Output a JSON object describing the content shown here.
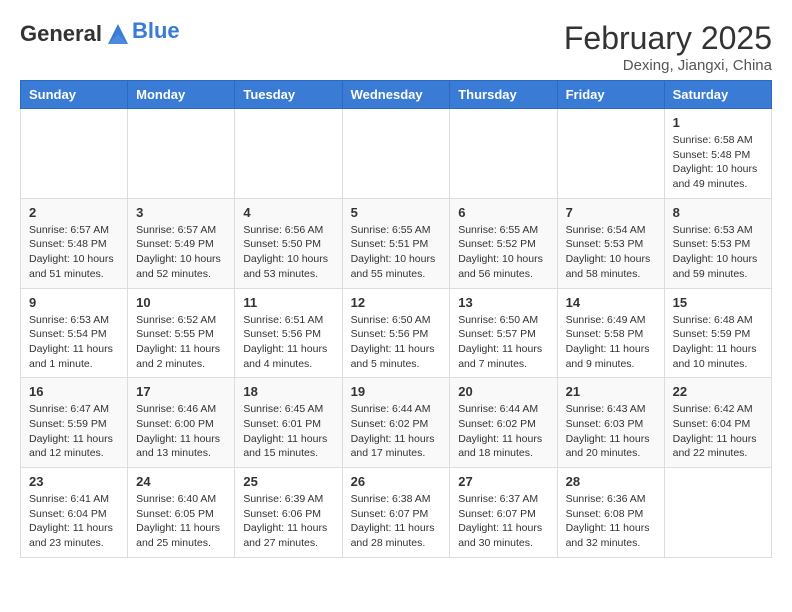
{
  "header": {
    "logo_general": "General",
    "logo_blue": "Blue",
    "month_year": "February 2025",
    "location": "Dexing, Jiangxi, China"
  },
  "weekdays": [
    "Sunday",
    "Monday",
    "Tuesday",
    "Wednesday",
    "Thursday",
    "Friday",
    "Saturday"
  ],
  "weeks": [
    [
      {
        "day": "",
        "info": ""
      },
      {
        "day": "",
        "info": ""
      },
      {
        "day": "",
        "info": ""
      },
      {
        "day": "",
        "info": ""
      },
      {
        "day": "",
        "info": ""
      },
      {
        "day": "",
        "info": ""
      },
      {
        "day": "1",
        "info": "Sunrise: 6:58 AM\nSunset: 5:48 PM\nDaylight: 10 hours and 49 minutes."
      }
    ],
    [
      {
        "day": "2",
        "info": "Sunrise: 6:57 AM\nSunset: 5:48 PM\nDaylight: 10 hours and 51 minutes."
      },
      {
        "day": "3",
        "info": "Sunrise: 6:57 AM\nSunset: 5:49 PM\nDaylight: 10 hours and 52 minutes."
      },
      {
        "day": "4",
        "info": "Sunrise: 6:56 AM\nSunset: 5:50 PM\nDaylight: 10 hours and 53 minutes."
      },
      {
        "day": "5",
        "info": "Sunrise: 6:55 AM\nSunset: 5:51 PM\nDaylight: 10 hours and 55 minutes."
      },
      {
        "day": "6",
        "info": "Sunrise: 6:55 AM\nSunset: 5:52 PM\nDaylight: 10 hours and 56 minutes."
      },
      {
        "day": "7",
        "info": "Sunrise: 6:54 AM\nSunset: 5:53 PM\nDaylight: 10 hours and 58 minutes."
      },
      {
        "day": "8",
        "info": "Sunrise: 6:53 AM\nSunset: 5:53 PM\nDaylight: 10 hours and 59 minutes."
      }
    ],
    [
      {
        "day": "9",
        "info": "Sunrise: 6:53 AM\nSunset: 5:54 PM\nDaylight: 11 hours and 1 minute."
      },
      {
        "day": "10",
        "info": "Sunrise: 6:52 AM\nSunset: 5:55 PM\nDaylight: 11 hours and 2 minutes."
      },
      {
        "day": "11",
        "info": "Sunrise: 6:51 AM\nSunset: 5:56 PM\nDaylight: 11 hours and 4 minutes."
      },
      {
        "day": "12",
        "info": "Sunrise: 6:50 AM\nSunset: 5:56 PM\nDaylight: 11 hours and 5 minutes."
      },
      {
        "day": "13",
        "info": "Sunrise: 6:50 AM\nSunset: 5:57 PM\nDaylight: 11 hours and 7 minutes."
      },
      {
        "day": "14",
        "info": "Sunrise: 6:49 AM\nSunset: 5:58 PM\nDaylight: 11 hours and 9 minutes."
      },
      {
        "day": "15",
        "info": "Sunrise: 6:48 AM\nSunset: 5:59 PM\nDaylight: 11 hours and 10 minutes."
      }
    ],
    [
      {
        "day": "16",
        "info": "Sunrise: 6:47 AM\nSunset: 5:59 PM\nDaylight: 11 hours and 12 minutes."
      },
      {
        "day": "17",
        "info": "Sunrise: 6:46 AM\nSunset: 6:00 PM\nDaylight: 11 hours and 13 minutes."
      },
      {
        "day": "18",
        "info": "Sunrise: 6:45 AM\nSunset: 6:01 PM\nDaylight: 11 hours and 15 minutes."
      },
      {
        "day": "19",
        "info": "Sunrise: 6:44 AM\nSunset: 6:02 PM\nDaylight: 11 hours and 17 minutes."
      },
      {
        "day": "20",
        "info": "Sunrise: 6:44 AM\nSunset: 6:02 PM\nDaylight: 11 hours and 18 minutes."
      },
      {
        "day": "21",
        "info": "Sunrise: 6:43 AM\nSunset: 6:03 PM\nDaylight: 11 hours and 20 minutes."
      },
      {
        "day": "22",
        "info": "Sunrise: 6:42 AM\nSunset: 6:04 PM\nDaylight: 11 hours and 22 minutes."
      }
    ],
    [
      {
        "day": "23",
        "info": "Sunrise: 6:41 AM\nSunset: 6:04 PM\nDaylight: 11 hours and 23 minutes."
      },
      {
        "day": "24",
        "info": "Sunrise: 6:40 AM\nSunset: 6:05 PM\nDaylight: 11 hours and 25 minutes."
      },
      {
        "day": "25",
        "info": "Sunrise: 6:39 AM\nSunset: 6:06 PM\nDaylight: 11 hours and 27 minutes."
      },
      {
        "day": "26",
        "info": "Sunrise: 6:38 AM\nSunset: 6:07 PM\nDaylight: 11 hours and 28 minutes."
      },
      {
        "day": "27",
        "info": "Sunrise: 6:37 AM\nSunset: 6:07 PM\nDaylight: 11 hours and 30 minutes."
      },
      {
        "day": "28",
        "info": "Sunrise: 6:36 AM\nSunset: 6:08 PM\nDaylight: 11 hours and 32 minutes."
      },
      {
        "day": "",
        "info": ""
      }
    ]
  ]
}
